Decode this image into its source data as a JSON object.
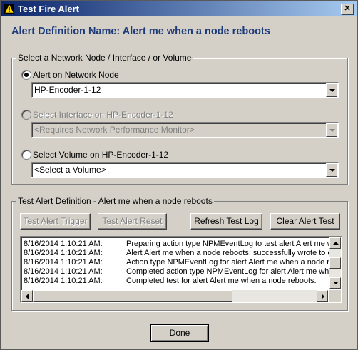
{
  "window": {
    "title": "Test Fire Alert",
    "close_glyph": "✕"
  },
  "heading": "Alert Definition Name: Alert me when a node reboots",
  "select_group": {
    "title": "Select a Network Node / Interface / or Volume",
    "options": [
      {
        "label": "Alert on Network Node",
        "selected": true,
        "enabled": true,
        "dropdown_value": "HP-Encoder-1-12"
      },
      {
        "label": "Select Interface on HP-Encoder-1-12",
        "selected": false,
        "enabled": false,
        "dropdown_value": "<Requires Network Performance Monitor>"
      },
      {
        "label": "Select Volume on HP-Encoder-1-12",
        "selected": false,
        "enabled": true,
        "dropdown_value": "<Select a Volume>"
      }
    ]
  },
  "test_group": {
    "title": "Test Alert Definition - Alert me when a node reboots",
    "buttons": {
      "trigger": "Test Alert Trigger",
      "reset": "Test Alert Reset",
      "refresh": "Refresh Test Log",
      "clear": "Clear Alert Test"
    },
    "log": [
      {
        "time": "8/16/2014 1:10:21 AM:",
        "message": "Preparing action type NPMEventLog to test alert Alert me w"
      },
      {
        "time": "8/16/2014 1:10:21 AM:",
        "message": "Alert Alert me when a node reboots: successfully wrote to ev"
      },
      {
        "time": "8/16/2014 1:10:21 AM:",
        "message": "Action type NPMEventLog for alert Alert me when a node re"
      },
      {
        "time": "8/16/2014 1:10:21 AM:",
        "message": "Completed action type NPMEventLog for alert Alert me whe"
      },
      {
        "time": "8/16/2014 1:10:21 AM:",
        "message": "Completed test for alert Alert me when a node reboots."
      }
    ]
  },
  "done_label": "Done",
  "icons": {
    "title": "warning-triangle-icon",
    "close": "close-icon",
    "dropdown": "chevron-down-icon"
  },
  "colors": {
    "titlebar_start": "#0a246a",
    "titlebar_end": "#a6caf0",
    "heading": "#1d3b79",
    "face": "#d4d0c8"
  }
}
